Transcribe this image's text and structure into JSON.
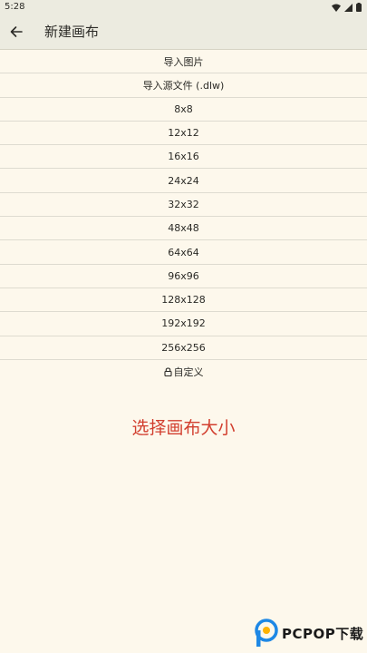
{
  "status": {
    "time": "5:28"
  },
  "header": {
    "title": "新建画布"
  },
  "list": {
    "items": [
      "导入图片",
      "导入源文件 (.dlw)",
      "8x8",
      "12x12",
      "16x16",
      "24x24",
      "32x32",
      "48x48",
      "64x64",
      "96x96",
      "128x128",
      "192x192",
      "256x256",
      "自定义"
    ]
  },
  "hint": "选择画布大小",
  "watermark": {
    "brand": "PCPOP下载"
  },
  "colors": {
    "background": "#fdf8ec",
    "app_bar": "#ecebe0",
    "hint": "#d23f2f",
    "watermark_accent": "#1e88e5"
  }
}
